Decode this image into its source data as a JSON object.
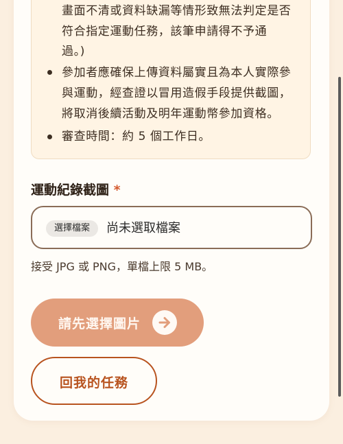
{
  "notice": {
    "lines": [
      "畫面不清或資料缺漏等情形致無法判定是否",
      "符合指定運動任務，該筆申請得不予通",
      "過。)",
      "參加者應確保上傳資料屬實且為本人實際參",
      "與運動，經查證以冒用造假手段提供截圖，",
      "將取消後續活動及明年運動幣參加資格。",
      "審查時間：約 5 個工作日。"
    ]
  },
  "form": {
    "label": "運動紀錄截圖",
    "required_mark": "*",
    "choose_button": "選擇檔案",
    "no_file_text": "尚未選取檔案",
    "hint": "接受 JPG 或 PNG，單檔上限 5 MB。"
  },
  "actions": {
    "submit_label": "請先選擇圖片",
    "back_label": "回我的任務"
  },
  "colors": {
    "accent": "#b8531f",
    "submit_disabled": "#e29e7c",
    "notice_bg": "#fff4e4"
  }
}
